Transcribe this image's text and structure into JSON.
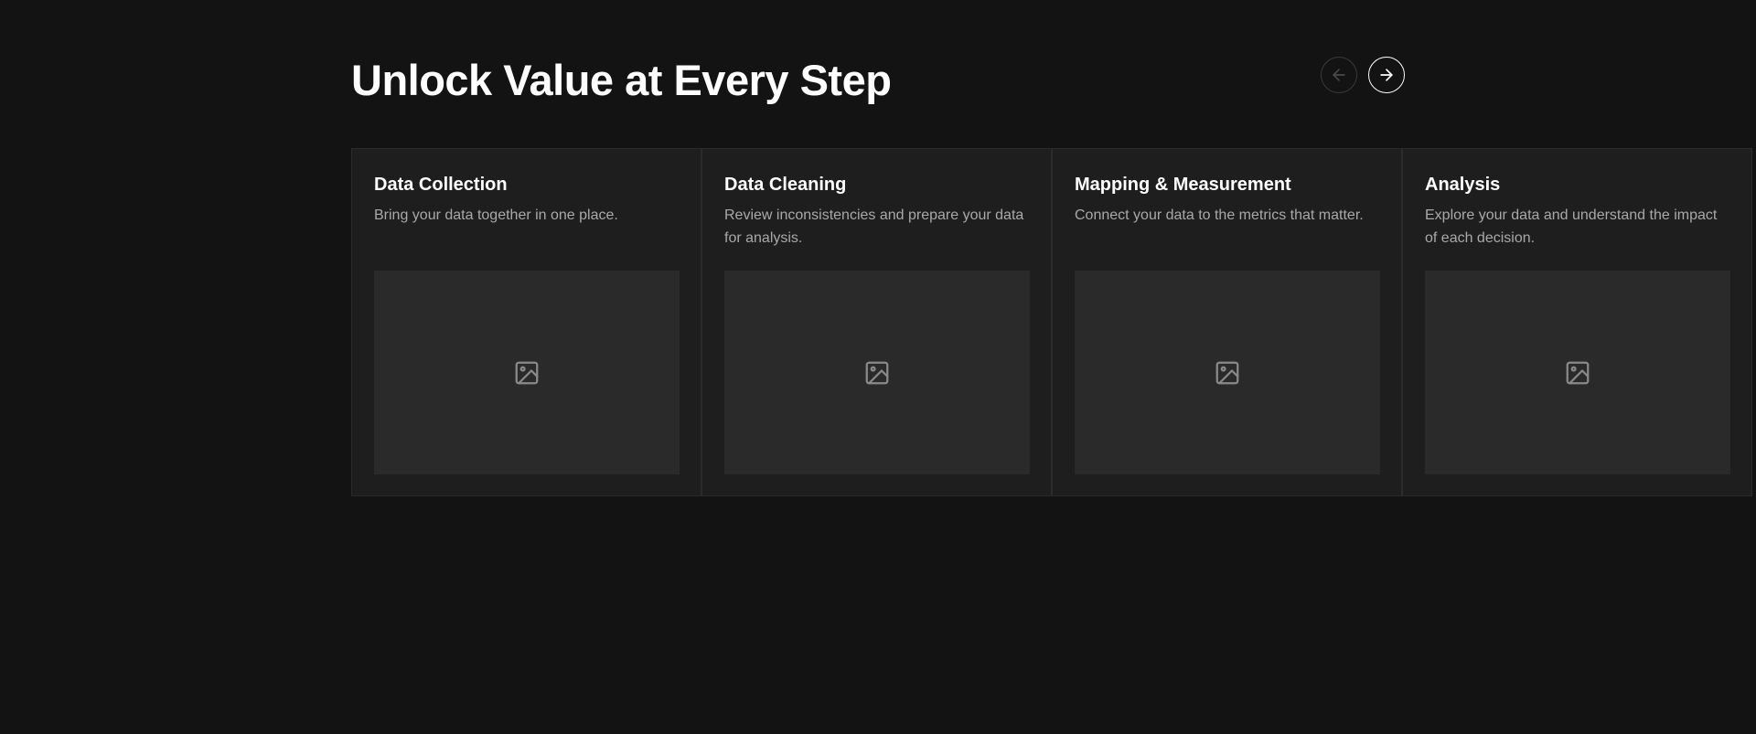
{
  "header": {
    "title": "Unlock Value at Every Step",
    "prev_icon": "arrow-left-icon",
    "next_icon": "arrow-right-icon"
  },
  "cards": [
    {
      "title": "Data Collection",
      "description": "Bring your data together in one place.",
      "media_icon": "image-placeholder-icon"
    },
    {
      "title": "Data Cleaning",
      "description": "Review inconsistencies and prepare your data for analysis.",
      "media_icon": "image-placeholder-icon"
    },
    {
      "title": "Mapping & Measurement",
      "description": "Connect your data to the metrics that matter.",
      "media_icon": "image-placeholder-icon"
    },
    {
      "title": "Analysis",
      "description": "Explore your data and understand the impact of each decision.",
      "media_icon": "image-placeholder-icon"
    }
  ],
  "colors": {
    "background": "#131313",
    "card_background": "#1e1e1e",
    "media_background": "#2a2a2a",
    "text_primary": "#ffffff",
    "text_secondary": "#a9a9a9"
  }
}
